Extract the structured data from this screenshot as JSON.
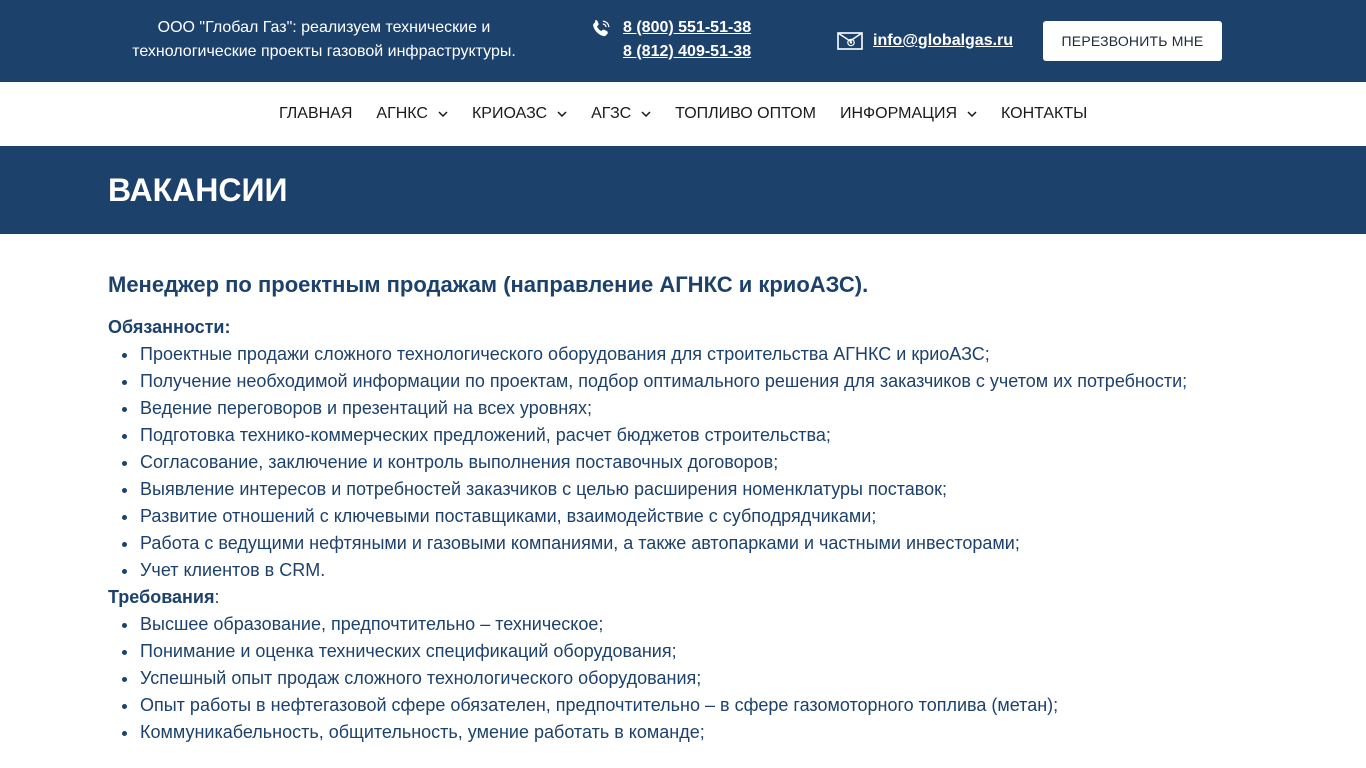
{
  "topbar": {
    "tagline": "ООО \"Глобал Газ\": реализуем технические и технологические проекты газовой инфраструктуры.",
    "phone_icon": "phone-icon",
    "phones": [
      "8 (800) 551-51-38",
      "8 (812) 409-51-38"
    ],
    "mail_icon": "envelope-icon",
    "email": "info@globalgas.ru",
    "callback_label": "ПЕРЕЗВОНИТЬ МНЕ"
  },
  "nav": {
    "items": [
      {
        "label": "ГЛАВНАЯ",
        "dropdown": false
      },
      {
        "label": "АГНКС",
        "dropdown": true
      },
      {
        "label": "КРИОАЗС",
        "dropdown": true
      },
      {
        "label": "АГЗС",
        "dropdown": true
      },
      {
        "label": "ТОПЛИВО ОПТОМ",
        "dropdown": false
      },
      {
        "label": "ИНФОРМАЦИЯ",
        "dropdown": true
      },
      {
        "label": "КОНТАКТЫ",
        "dropdown": false
      }
    ]
  },
  "hero": {
    "title": "ВАКАНСИИ"
  },
  "vacancy": {
    "title": "Менеджер по проектным продажам (направление АГНКС и криоАЗС).",
    "duties_label": "Обязанности:",
    "duties": [
      "Проектные продажи сложного технологического оборудования для строительства АГНКС и криоАЗС;",
      "Получение необходимой информации по проектам, подбор оптимального решения для заказчиков с учетом их потребности;",
      "Ведение переговоров и презентаций на всех уровнях;",
      "Подготовка технико-коммерческих предложений, расчет бюджетов строительства;",
      "Согласование, заключение и контроль выполнения поставочных договоров;",
      "Выявление интересов и потребностей заказчиков с целью расширения номенклатуры поставок;",
      "Развитие отношений с ключевыми поставщиками, взаимодействие с субподрядчиками;",
      "Работа с ведущими нефтяными и газовыми компаниями, а также автопарками и частными инвесторами;",
      "Учет клиентов в CRM."
    ],
    "requirements_label": "Требования",
    "requirements_colon": ":",
    "requirements": [
      "Высшее образование, предпочтительно – техническое;",
      "Понимание и оценка технических спецификаций оборудования;",
      "Успешный опыт продаж сложного технологического оборудования;",
      "Опыт работы в нефтегазовой сфере обязателен, предпочтительно – в сфере газомоторного топлива (метан);",
      "Коммуникабельность, общительность, умение работать в команде;"
    ]
  },
  "colors": {
    "brand_dark": "#1c416b",
    "text": "#1c416b",
    "nav_text": "#1a1a1a",
    "white": "#ffffff"
  }
}
